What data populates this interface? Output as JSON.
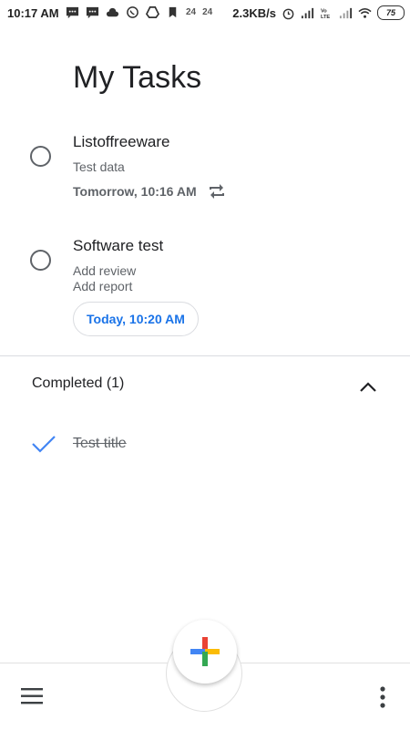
{
  "status_bar": {
    "time": "10:17 AM",
    "num1": "24",
    "num2": "24",
    "net_speed": "2.3KB/s",
    "battery": "75"
  },
  "header": {
    "title": "My Tasks"
  },
  "tasks": [
    {
      "title": "Listoffreeware",
      "notes": [
        "Test data"
      ],
      "due": "Tomorrow, 10:16 AM",
      "repeat": true
    },
    {
      "title": "Software test",
      "notes": [
        "Add review",
        "Add report"
      ],
      "due": "Today, 10:20 AM",
      "repeat": false
    }
  ],
  "completed": {
    "header": "Completed (1)",
    "items": [
      {
        "title": "Test title"
      }
    ]
  },
  "colors": {
    "accent": "#1a73e8",
    "text": "#202124",
    "secondary": "#5f6368"
  },
  "icons": [
    "menu-icon",
    "more-vert-icon",
    "add-icon",
    "repeat-icon",
    "check-icon",
    "chevron-up-icon"
  ]
}
